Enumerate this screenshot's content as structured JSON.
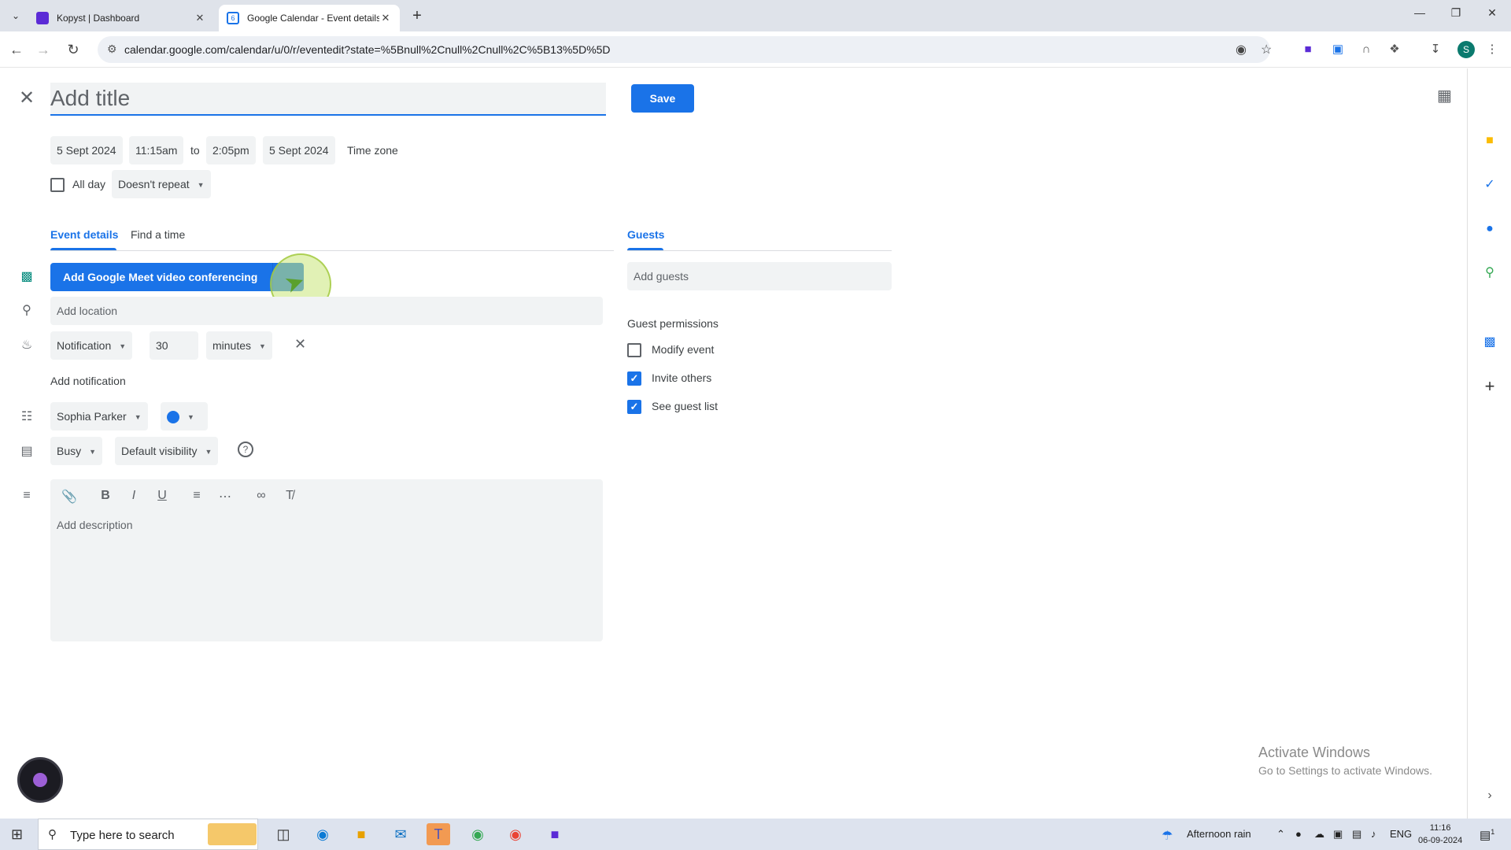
{
  "browser": {
    "tabs": [
      {
        "title": "Kopyst | Dashboard"
      },
      {
        "title": "Google Calendar - Event details"
      }
    ],
    "url": "calendar.google.com/calendar/u/0/r/eventedit?state=%5Bnull%2Cnull%2Cnull%2C%5B13%5D%5D",
    "profile_initial": "S"
  },
  "header": {
    "title_placeholder": "Add title",
    "save_label": "Save",
    "avatar_initial": "S"
  },
  "datetime": {
    "start_date": "5 Sept 2024",
    "start_time": "11:15am",
    "to_label": "to",
    "end_time": "2:05pm",
    "end_date": "5 Sept 2024",
    "timezone_label": "Time zone",
    "all_day_label": "All day",
    "repeat": "Doesn't repeat"
  },
  "tabs": {
    "event_details": "Event details",
    "find_time": "Find a time",
    "guests": "Guests"
  },
  "details": {
    "meet_button": "Add Google Meet video conferencing",
    "location_placeholder": "Add location",
    "notification_type": "Notification",
    "notification_value": "30",
    "notification_unit": "minutes",
    "add_notification": "Add notification",
    "calendar_owner": "Sophia Parker",
    "event_color": "#1a73e8",
    "availability": "Busy",
    "visibility": "Default visibility",
    "description_placeholder": "Add description"
  },
  "guests": {
    "add_placeholder": "Add guests",
    "permissions_title": "Guest permissions",
    "permissions": [
      {
        "label": "Modify event",
        "checked": false
      },
      {
        "label": "Invite others",
        "checked": true
      },
      {
        "label": "See guest list",
        "checked": true
      }
    ]
  },
  "watermark": {
    "line1": "Activate Windows",
    "line2": "Go to Settings to activate Windows."
  },
  "taskbar": {
    "search_placeholder": "Type here to search",
    "weather": "Afternoon rain",
    "language": "ENG",
    "time": "11:16",
    "date": "06-09-2024",
    "notification_count": "1"
  },
  "colors": {
    "accent": "#1a73e8",
    "field_bg": "#f1f3f4"
  }
}
